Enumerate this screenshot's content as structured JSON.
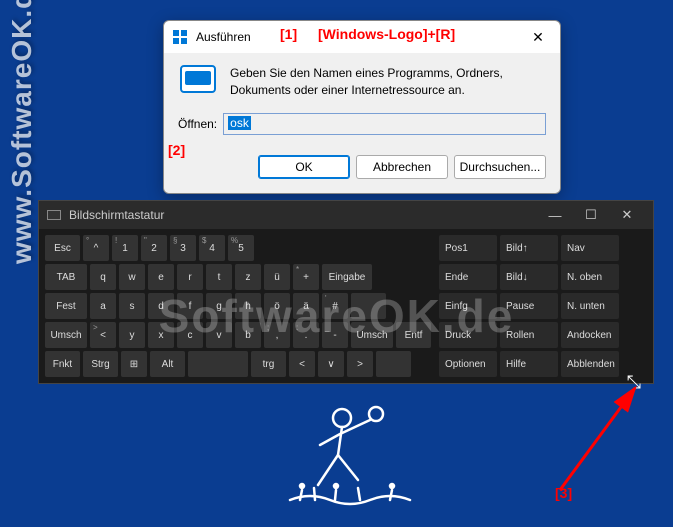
{
  "watermark": {
    "side": "www.SoftwareOK.de :-)",
    "center": "SoftwareOK.de"
  },
  "annotations": {
    "one": "[1]",
    "one_text": "[Windows-Logo]+[R]",
    "two": "[2]",
    "three": "[3]"
  },
  "run": {
    "title": "Ausführen",
    "description": "Geben Sie den Namen eines Programms, Ordners, Dokuments oder einer Internetressource an.",
    "input_label": "Öffnen:",
    "input_value": "osk",
    "buttons": {
      "ok": "OK",
      "cancel": "Abbrechen",
      "browse": "Durchsuchen..."
    }
  },
  "osk": {
    "title": "Bildschirmtastatur",
    "rows_main": [
      [
        {
          "l": "Esc",
          "w": "w15"
        },
        {
          "l": "^",
          "s": "°",
          "w": "w1"
        },
        {
          "l": "1",
          "s": "!",
          "w": "w1"
        },
        {
          "l": "2",
          "s": "\"",
          "w": "w1"
        },
        {
          "l": "3",
          "s": "§",
          "w": "w1"
        },
        {
          "l": "4",
          "s": "$",
          "w": "w1"
        },
        {
          "l": "5",
          "s": "%",
          "w": "w1"
        }
      ],
      [
        {
          "l": "TAB",
          "w": "w2"
        },
        {
          "l": "q",
          "w": "w1"
        },
        {
          "l": "w",
          "w": "w1"
        },
        {
          "l": "e",
          "w": "w1"
        },
        {
          "l": "r",
          "w": "w1"
        },
        {
          "l": "t",
          "w": "w1"
        },
        {
          "l": "z",
          "w": "w1"
        }
      ],
      [
        {
          "l": "Fest",
          "w": "w2"
        },
        {
          "l": "a",
          "w": "w1"
        },
        {
          "l": "s",
          "w": "w1"
        },
        {
          "l": "d",
          "w": "w1"
        },
        {
          "l": "f",
          "w": "w1"
        },
        {
          "l": "g",
          "w": "w1"
        },
        {
          "l": "h",
          "w": "w1"
        }
      ],
      [
        {
          "l": "Umsch",
          "w": "w2"
        },
        {
          "l": "<",
          "s": ">",
          "w": "w1"
        },
        {
          "l": "y",
          "w": "w1"
        },
        {
          "l": "x",
          "w": "w1"
        },
        {
          "l": "c",
          "w": "w1"
        },
        {
          "l": "v",
          "w": "w1"
        },
        {
          "l": "b",
          "w": "w1"
        }
      ],
      [
        {
          "l": "Fnkt",
          "w": "w15"
        },
        {
          "l": "Strg",
          "w": "w15"
        },
        {
          "l": "⊞",
          "w": "w1"
        },
        {
          "l": "Alt",
          "w": "w15"
        },
        {
          "l": "",
          "w": "space"
        }
      ]
    ],
    "rows_mid": [
      [
        {
          "l": "ü",
          "w": "w1"
        },
        {
          "l": "+",
          "s": "*",
          "w": "w1"
        },
        {
          "l": "Eingabe",
          "w": "w25"
        }
      ],
      [
        {
          "l": "ö",
          "w": "w1"
        },
        {
          "l": "ä",
          "w": "w1"
        },
        {
          "l": "#",
          "s": "'",
          "w": "w1"
        },
        {
          "l": "",
          "w": "w15"
        }
      ],
      [
        {
          "l": ",",
          "s": ";",
          "w": "w1"
        },
        {
          "l": ".",
          "s": ":",
          "w": "w1"
        },
        {
          "l": "-",
          "s": "_",
          "w": "w1"
        },
        {
          "l": "Umsch",
          "w": "w2"
        },
        {
          "l": "Entf",
          "w": "w15"
        }
      ],
      [
        {
          "l": "trg",
          "w": "w15"
        },
        {
          "l": "<",
          "w": "w1"
        },
        {
          "l": "∨",
          "w": "w1"
        },
        {
          "l": ">",
          "w": "w1"
        },
        {
          "l": "",
          "w": "w15"
        }
      ]
    ],
    "rows_side": [
      [
        {
          "l": "Pos1"
        },
        {
          "l": "Bild↑"
        },
        {
          "l": "Nav"
        }
      ],
      [
        {
          "l": "Ende"
        },
        {
          "l": "Bild↓"
        },
        {
          "l": "N. oben"
        }
      ],
      [
        {
          "l": "Einfg"
        },
        {
          "l": "Pause"
        },
        {
          "l": "N. unten"
        }
      ],
      [
        {
          "l": "Druck"
        },
        {
          "l": "Rollen"
        },
        {
          "l": "Andocken"
        }
      ],
      [
        {
          "l": "Optionen"
        },
        {
          "l": "Hilfe"
        },
        {
          "l": "Abblenden"
        }
      ]
    ]
  }
}
